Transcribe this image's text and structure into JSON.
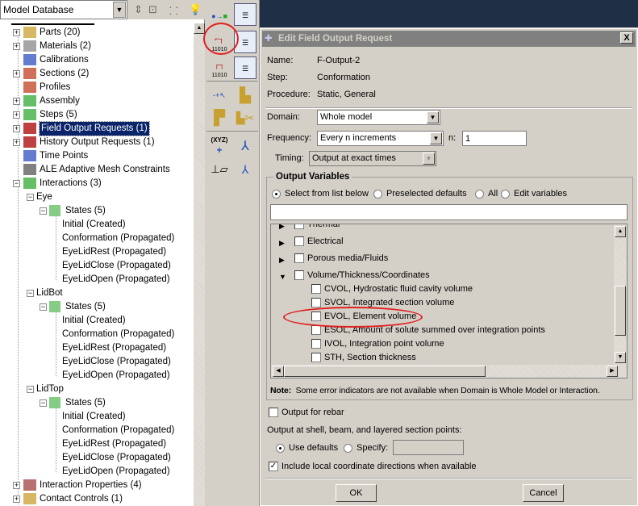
{
  "tree": {
    "combo_value": "Model Database",
    "items": [
      {
        "label": "Parts (20)",
        "expander": "+",
        "icon": "part-icon"
      },
      {
        "label": "Materials (2)",
        "expander": "+",
        "icon": "material-icon"
      },
      {
        "label": "Calibrations",
        "expander": "",
        "icon": "calibration-icon"
      },
      {
        "label": "Sections (2)",
        "expander": "+",
        "icon": "section-icon"
      },
      {
        "label": "Profiles",
        "expander": "",
        "icon": "profile-icon"
      },
      {
        "label": "Assembly",
        "expander": "+",
        "icon": "assembly-icon"
      },
      {
        "label": "Steps (5)",
        "expander": "+",
        "icon": "steps-icon"
      },
      {
        "label": "Field Output Requests (1)",
        "expander": "+",
        "icon": "field-output-icon",
        "selected": true
      },
      {
        "label": "History Output Requests (1)",
        "expander": "+",
        "icon": "history-output-icon"
      },
      {
        "label": "Time Points",
        "expander": "",
        "icon": "time-points-icon"
      },
      {
        "label": "ALE Adaptive Mesh Constraints",
        "expander": "",
        "icon": "ale-icon"
      },
      {
        "label": "Interactions (3)",
        "expander": "-",
        "icon": "interaction-icon"
      }
    ],
    "interactions": [
      {
        "name": "Eye",
        "states_label": "States (5)",
        "states": [
          "Initial (Created)",
          "Conformation (Propagated)",
          "EyeLidRest (Propagated)",
          "EyeLidClose (Propagated)",
          "EyeLidOpen (Propagated)"
        ]
      },
      {
        "name": "LidBot",
        "states_label": "States (5)",
        "states": [
          "Initial (Created)",
          "Conformation (Propagated)",
          "EyeLidRest (Propagated)",
          "EyeLidClose (Propagated)",
          "EyeLidOpen (Propagated)"
        ]
      },
      {
        "name": "LidTop",
        "states_label": "States (5)",
        "states": [
          "Initial (Created)",
          "Conformation (Propagated)",
          "EyeLidRest (Propagated)",
          "EyeLidClose (Propagated)",
          "EyeLidOpen (Propagated)"
        ]
      }
    ],
    "bottom_items": [
      {
        "label": "Interaction Properties (4)",
        "icon": "interaction-property-icon"
      },
      {
        "label": "Contact Controls (1)",
        "icon": "contact-control-icon"
      }
    ]
  },
  "toolbox": {
    "xyz_label": "(XYZ)",
    "bits_label": "11010"
  },
  "dialog": {
    "title": "Edit Field Output Request",
    "close": "X",
    "name_label": "Name:",
    "name_value": "F-Output-2",
    "step_label": "Step:",
    "step_value": "Conformation",
    "procedure_label": "Procedure:",
    "procedure_value": "Static, General",
    "domain_label": "Domain:",
    "domain_value": "Whole model",
    "frequency_label": "Frequency:",
    "frequency_value": "Every n increments",
    "n_label": "n:",
    "n_value": "1",
    "timing_label": "Timing:",
    "timing_value": "Output at exact times",
    "output_vars_title": "Output Variables",
    "radios": [
      {
        "label": "Select from list below",
        "checked": true
      },
      {
        "label": "Preselected defaults",
        "checked": false
      },
      {
        "label": "All",
        "checked": false
      },
      {
        "label": "Edit variables",
        "checked": false
      }
    ],
    "variables_text": "",
    "categories": [
      {
        "label": "Thermal",
        "expanded": false
      },
      {
        "label": "Electrical",
        "expanded": false
      },
      {
        "label": "Porous media/Fluids",
        "expanded": false
      },
      {
        "label": "Volume/Thickness/Coordinates",
        "expanded": true
      }
    ],
    "variables": [
      {
        "label": "CVOL, Hydrostatic fluid cavity volume",
        "checked": false
      },
      {
        "label": "SVOL, Integrated section volume",
        "checked": false
      },
      {
        "label": "EVOL, Element volume",
        "checked": false,
        "highlighted": true
      },
      {
        "label": "ESOL, Amount of solute summed over integration points",
        "checked": false
      },
      {
        "label": "IVOL, Integration point volume",
        "checked": false
      },
      {
        "label": "STH, Section thickness",
        "checked": false
      }
    ],
    "note_bold": "Note:",
    "note_text": "Some error indicators are not available when Domain is Whole Model or Interaction.",
    "rebar_label": "Output for rebar",
    "rebar_checked": false,
    "section_points_label": "Output at shell, beam, and layered section points:",
    "use_defaults_label": "Use defaults",
    "specify_label": "Specify:",
    "specify_value": "",
    "local_coord_label": "Include local coordinate directions when available",
    "local_coord_checked": true,
    "ok_label": "OK",
    "cancel_label": "Cancel"
  },
  "colors": {
    "selection": "#0a246a",
    "highlight_circle": "#e02020",
    "title_bar": "#808080",
    "background": "#d4d0c8"
  }
}
